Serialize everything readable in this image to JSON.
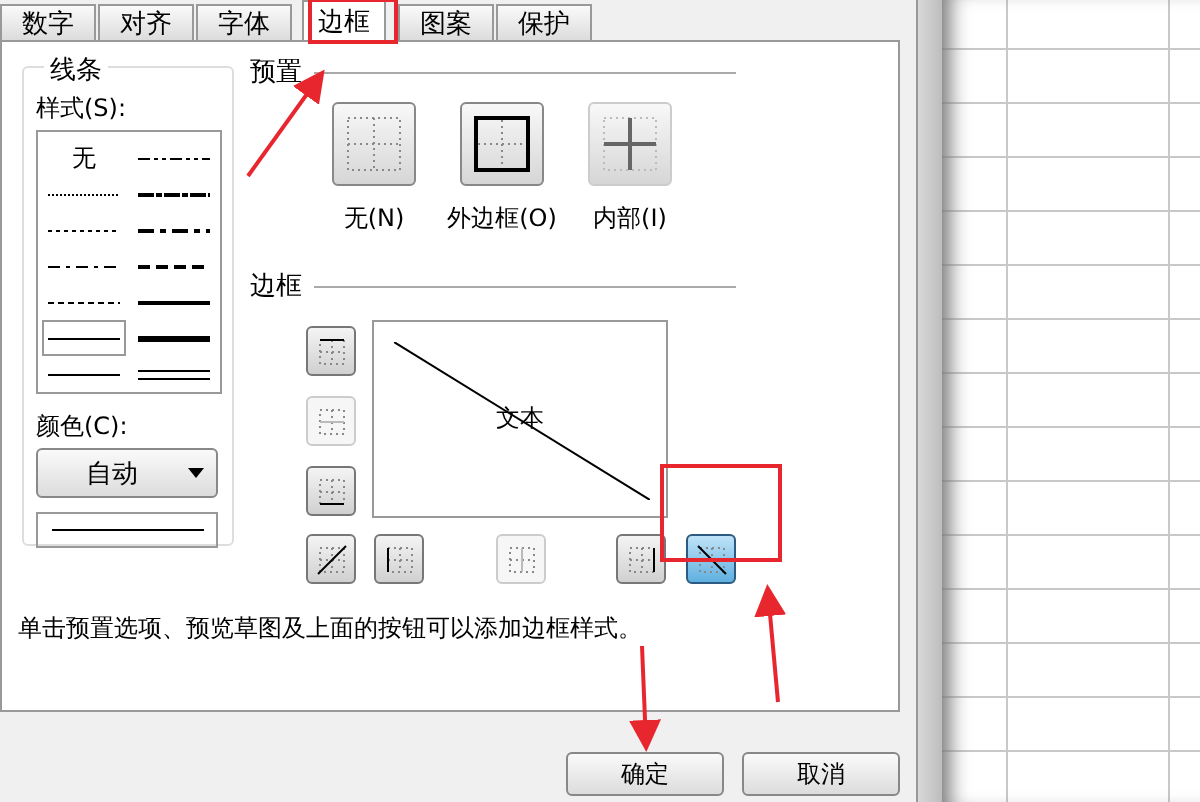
{
  "tabs": [
    {
      "label": "数字",
      "selected": false
    },
    {
      "label": "对齐",
      "selected": false
    },
    {
      "label": "字体",
      "selected": false
    },
    {
      "label": "边框",
      "selected": true
    },
    {
      "label": "图案",
      "selected": false
    },
    {
      "label": "保护",
      "selected": false
    }
  ],
  "line": {
    "title": "线条",
    "style_label": "样式(S):",
    "styles": [
      {
        "kind": "none",
        "label": "无",
        "selected": false
      },
      {
        "kind": "dash-dot-dot",
        "selected": false
      },
      {
        "kind": "hair",
        "selected": false
      },
      {
        "kind": "slant-dash-dot",
        "selected": false
      },
      {
        "kind": "dotted",
        "selected": false
      },
      {
        "kind": "medium-dash-dot",
        "selected": false
      },
      {
        "kind": "dash-dot",
        "selected": false
      },
      {
        "kind": "medium-dashed",
        "selected": false
      },
      {
        "kind": "dashed",
        "selected": false
      },
      {
        "kind": "medium",
        "selected": false
      },
      {
        "kind": "thin",
        "selected": true
      },
      {
        "kind": "thick",
        "selected": false
      },
      {
        "kind": "thin",
        "selected": false
      },
      {
        "kind": "double",
        "selected": false
      }
    ],
    "color_label": "颜色(C):",
    "color_value": "自动"
  },
  "presets": {
    "title": "预置",
    "items": [
      {
        "kind": "none",
        "label": "无(N)",
        "disabled": false
      },
      {
        "kind": "outline",
        "label": "外边框(O)",
        "disabled": false
      },
      {
        "kind": "inside",
        "label": "内部(I)",
        "disabled": true
      }
    ]
  },
  "border": {
    "title": "边框",
    "preview_text": "文本",
    "side_buttons": [
      {
        "kind": "top",
        "pressed": false,
        "disabled": false
      },
      {
        "kind": "middle-h",
        "pressed": false,
        "disabled": true
      },
      {
        "kind": "bottom",
        "pressed": false,
        "disabled": false
      }
    ],
    "bottom_buttons": [
      {
        "kind": "diag-up",
        "pressed": false,
        "disabled": false
      },
      {
        "kind": "left",
        "pressed": false,
        "disabled": false
      },
      {
        "kind": "middle-v",
        "pressed": false,
        "disabled": true
      },
      {
        "kind": "right",
        "pressed": false,
        "disabled": false
      },
      {
        "kind": "diag-down",
        "pressed": true,
        "disabled": false
      }
    ]
  },
  "hint": "单击预置选项、预览草图及上面的按钮可以添加边框样式。",
  "buttons": [
    "确定",
    "取消"
  ]
}
